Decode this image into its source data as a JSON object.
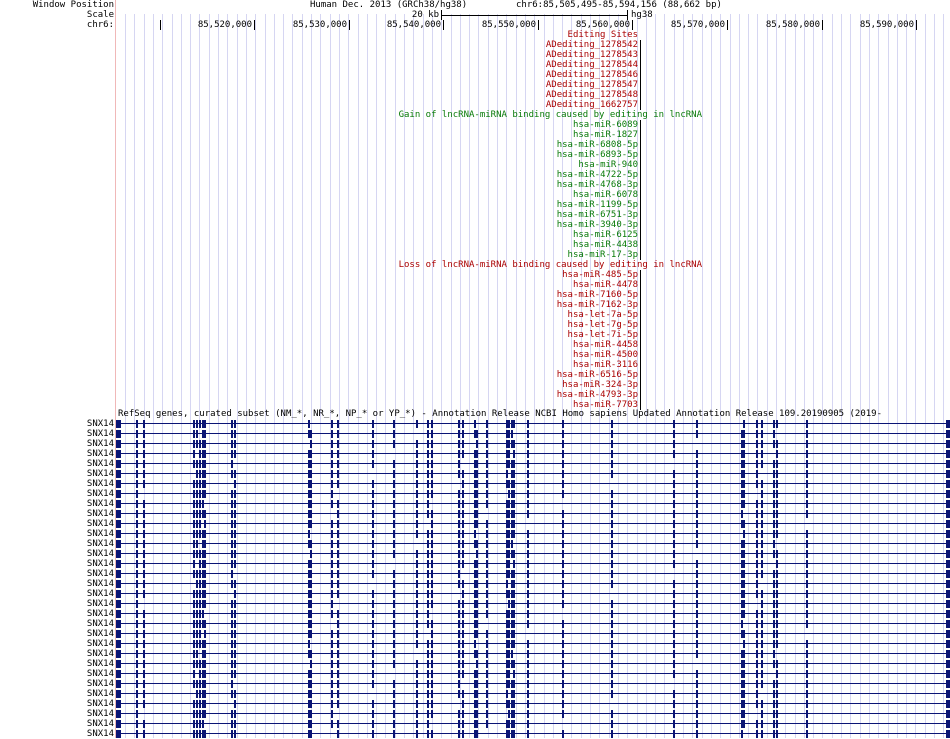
{
  "header": {
    "window_position_label": "Window Position",
    "scale_label": "Scale",
    "chrom_label": "chr6:",
    "assembly": "Human Dec. 2013 (GRCh38/hg38)",
    "position": "chr6:85,505,495-85,594,156 (88,662 bp)",
    "scale_text": "20 kb",
    "scale_db": "hg38"
  },
  "ruler": {
    "ticks": [
      "85,520,000",
      "85,530,000",
      "85,540,000",
      "85,550,000",
      "85,560,000",
      "85,570,000",
      "85,580,000",
      "85,590,000"
    ]
  },
  "tracks": {
    "editing": {
      "title": "Editing Sites",
      "color": "#aa0000",
      "items": [
        "ADediting_1278542",
        "ADediting_1278543",
        "ADediting_1278544",
        "ADediting_1278546",
        "ADediting_1278547",
        "ADediting_1278548",
        "ADediting_1662757"
      ]
    },
    "gain": {
      "title": "Gain of lncRNA-miRNA binding caused by editing in lncRNA",
      "color": "#087a08",
      "items": [
        "hsa-miR-6089",
        "hsa-miR-1827",
        "hsa-miR-6808-5p",
        "hsa-miR-6893-5p",
        "hsa-miR-940",
        "hsa-miR-4722-5p",
        "hsa-miR-4768-3p",
        "hsa-miR-6078",
        "hsa-miR-1199-5p",
        "hsa-miR-6751-3p",
        "hsa-miR-3940-3p",
        "hsa-miR-6125",
        "hsa-miR-4438",
        "hsa-miR-17-3p"
      ]
    },
    "loss": {
      "title": "Loss of lncRNA-miRNA binding caused by editing in lncRNA",
      "color": "#aa0000",
      "items": [
        "hsa-miR-485-5p",
        "hsa-miR-4478",
        "hsa-miR-7160-5p",
        "hsa-miR-7162-3p",
        "hsa-let-7a-5p",
        "hsa-let-7g-5p",
        "hsa-let-7i-5p",
        "hsa-miR-4458",
        "hsa-miR-4500",
        "hsa-miR-3116",
        "hsa-miR-6516-5p",
        "hsa-miR-324-3p",
        "hsa-miR-4793-3p",
        "hsa-miR-7703"
      ]
    },
    "genes": {
      "title": "RefSeq genes, curated subset (NM_*, NR_*, NP_* or YP_*) - Annotation Release NCBI Homo sapiens Updated Annotation Release 109.20190905 (2019-",
      "color": "#0b1575",
      "rows": [
        "SNX14",
        "SNX14",
        "SNX14",
        "SNX14",
        "SNX14",
        "SNX14",
        "SNX14",
        "SNX14",
        "SNX14",
        "SNX14",
        "SNX14",
        "SNX14",
        "SNX14",
        "SNX14",
        "SNX14",
        "SNX14",
        "SNX14",
        "SNX14",
        "SNX14",
        "SNX14",
        "SNX14",
        "SNX14",
        "SNX14",
        "SNX14",
        "SNX14",
        "SNX14",
        "SNX14",
        "SNX14",
        "SNX14",
        "SNX14",
        "SNX14",
        "SNX14"
      ]
    }
  }
}
